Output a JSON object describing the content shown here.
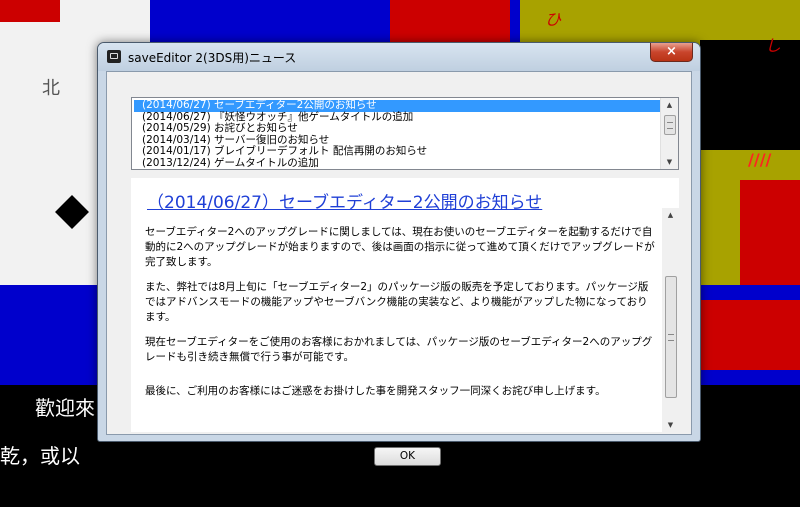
{
  "window": {
    "title": "saveEditor 2(3DS用)ニュース",
    "close_label": "×"
  },
  "news_list": {
    "items": [
      "(2014/06/27) セーブエディター2公開のお知らせ",
      "(2014/06/27) 『妖怪ウオッチ』他ゲームタイトルの追加",
      "(2014/05/29) お詫びとお知らせ",
      "(2014/03/14) サーバー復旧のお知らせ",
      "(2014/01/17) ブレイブリーデフォルト 配信再開のお知らせ",
      "(2013/12/24) ゲームタイトルの追加"
    ],
    "selected_index": 0
  },
  "article": {
    "title": "（2014/06/27）セーブエディター2公開のお知らせ",
    "paragraphs": [
      "セーブエディター2へのアップグレードに関しましては、現在お使いのセーブエディターを起動するだけで自動的に2へのアップグレードが始まりますので、後は画面の指示に従って進めて頂くだけでアップグレードが完了致します。",
      "また、弊社では8月上旬に「セーブエディター2」のパッケージ版の販売を予定しております。パッケージ版ではアドバンスモードの機能アップやセーブバンク機能の実装など、より機能がアップした物になっております。",
      "現在セーブエディターをご使用のお客様におかれましては、パッケージ版のセーブエディター2へのアップグレードも引き続き無償で行う事が可能です。",
      "最後に、ご利用のお客様にはご迷惑をお掛けした事を開発スタッフ一同深くお詫び申し上げます。"
    ]
  },
  "buttons": {
    "ok_label": "OK"
  },
  "background": {
    "text_bottom_1": "歡迎來",
    "text_bottom_2": "乾，或以",
    "north_label": "北",
    "glyph_1": "ひ",
    "glyph_2": "し",
    "red_marks": "////"
  },
  "colors": {
    "selection": "#3399ff",
    "link": "#1f3fd6",
    "close_button": "#c9452c"
  }
}
